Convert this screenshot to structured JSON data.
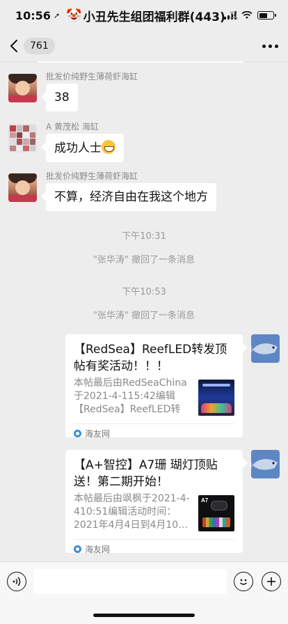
{
  "status_bar": {
    "time": "10:56"
  },
  "nav": {
    "unread_count": "761",
    "title": "小丑先生组团福利群(443)"
  },
  "messages": [
    {
      "sender": "批发价纯野生薄荷虾海缸",
      "text": "38"
    },
    {
      "sender": "A  黄茂松 海缸",
      "text": "成功人士"
    },
    {
      "sender": "批发价纯野生薄荷虾海缸",
      "text": "不算，经济自由在我这个地方"
    }
  ],
  "system": [
    {
      "time": "下午10:31",
      "note": "\"张华涛\" 撤回了一条消息"
    },
    {
      "time": "下午10:53",
      "note": "\"张华涛\" 撤回了一条消息"
    }
  ],
  "cards": [
    {
      "title": "【RedSea】ReefLED转发顶帖有奖活动！！！",
      "desc": "本帖最后由RedSeaChina于2021-4-115:42编辑【RedSea】ReefLED转发…",
      "source": "海友网"
    },
    {
      "title": "【A+智控】A7珊 瑚灯顶贴送！第二期开始！",
      "desc": "本帖最后由飒枫于2021-4-410:51编辑活动时间：2021年4月4日到4月10…",
      "thumb_label": "A7",
      "source": "海友网"
    }
  ],
  "input": {
    "value": ""
  }
}
